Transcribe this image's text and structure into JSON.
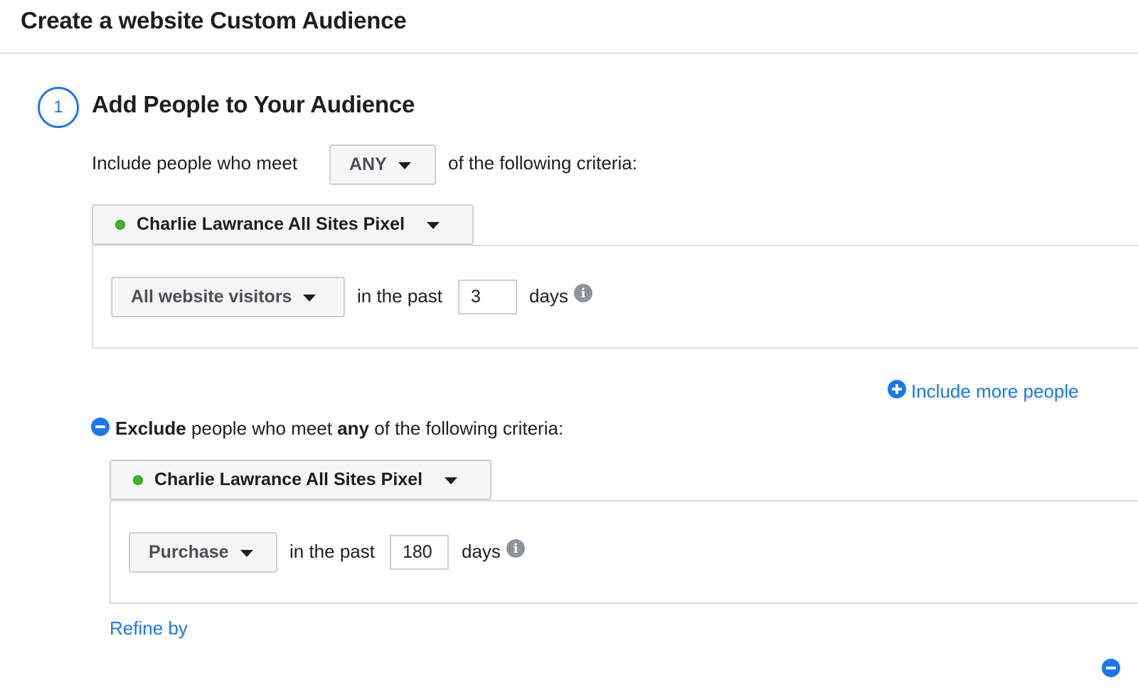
{
  "header": {
    "title": "Create a website Custom Audience"
  },
  "step": {
    "number": "1",
    "title": "Add People to Your Audience"
  },
  "include": {
    "prefix": "Include people who meet",
    "match_value": "ANY",
    "suffix": "of the following criteria:",
    "pixel_name": "Charlie Lawrance All Sites Pixel",
    "rule": {
      "event": "All website visitors",
      "in_the_past_label": "in the past",
      "days_value": "3",
      "days_label": "days"
    },
    "more_link": "Include more people"
  },
  "exclude": {
    "lead_bold": "Exclude",
    "mid_text": "people who meet",
    "any_bold": "any",
    "suffix": "of the following criteria:",
    "pixel_name": "Charlie Lawrance All Sites Pixel",
    "rule": {
      "event": "Purchase",
      "in_the_past_label": "in the past",
      "days_value": "180",
      "days_label": "days"
    },
    "refine_link": "Refine by"
  },
  "colors": {
    "accent": "#1877f2",
    "pixel_status": "#42b72a",
    "info_icon": "#8d949e"
  }
}
